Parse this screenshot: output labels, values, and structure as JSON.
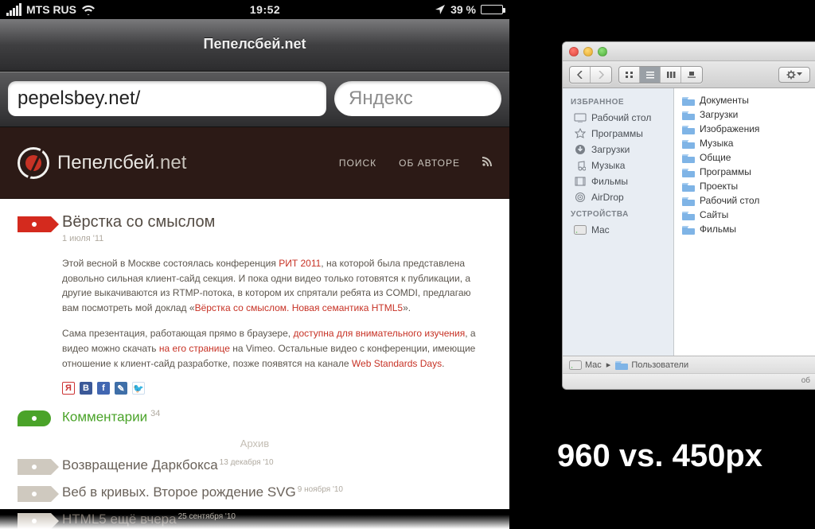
{
  "statusbar": {
    "carrier": "MTS RUS",
    "time": "19:52",
    "battery_pct": "39 %"
  },
  "safari": {
    "page_title": "Пепелсбей.net",
    "url": "pepelsbey.net/",
    "search_placeholder": "Яндекс"
  },
  "site": {
    "brand": "Пепелсбей",
    "tld": ".net",
    "nav_search": "ПОИСК",
    "nav_about": "ОБ АВТОРЕ"
  },
  "post": {
    "title": "Вёрстка со смыслом",
    "date": "1 июля '11",
    "p1_a": "Этой весной в Москве состоялась конференция ",
    "p1_link1": "РИТ 2011",
    "p1_b": ", на которой была представлена довольно сильная клиент-сайд секция. И пока одни видео только готовятся к публикации, а другие выкачиваются из RTMP-потока, в котором их спрятали ребята из COMDI, предлагаю вам посмотреть мой доклад «",
    "p1_link2": "Вёрстка со смыслом. Новая семантика HTML5",
    "p1_c": "».",
    "p2_a": "Сама презентация, работающая прямо в браузере, ",
    "p2_link1": "доступна для внимательного изучения",
    "p2_b": ", а видео можно скачать ",
    "p2_link2": "на его странице",
    "p2_c": " на Vimeo. Остальные видео с конференции, имеющие отношение к клиент-сайд разработке, позже появятся на канале ",
    "p2_link3": "Web Standards Days",
    "p2_d": "."
  },
  "comments": {
    "label": "Комментарии",
    "count": "34"
  },
  "archive": {
    "heading": "Архив",
    "items": [
      {
        "title": "Возвращение Даркбокса",
        "date": "13 декабря '10"
      },
      {
        "title": "Веб в кривых. Второе рождение SVG",
        "date": "9 ноября '10"
      },
      {
        "title": "HTML5 ещё вчера",
        "date": "25 сентября '10"
      }
    ]
  },
  "finder": {
    "sidebar": {
      "s1": "ИЗБРАННОЕ",
      "s1_items": [
        "Рабочий стол",
        "Программы",
        "Загрузки",
        "Музыка",
        "Фильмы",
        "AirDrop"
      ],
      "s2": "УСТРОЙСТВА",
      "s2_items": [
        "Mac"
      ]
    },
    "files": [
      "Документы",
      "Загрузки",
      "Изображения",
      "Музыка",
      "Общие",
      "Программы",
      "Проекты",
      "Рабочий стол",
      "Сайты",
      "Фильмы"
    ],
    "path": {
      "root": "Mac",
      "folder": "Пользователи"
    },
    "status": "об"
  },
  "caption": "960 vs. 450px"
}
